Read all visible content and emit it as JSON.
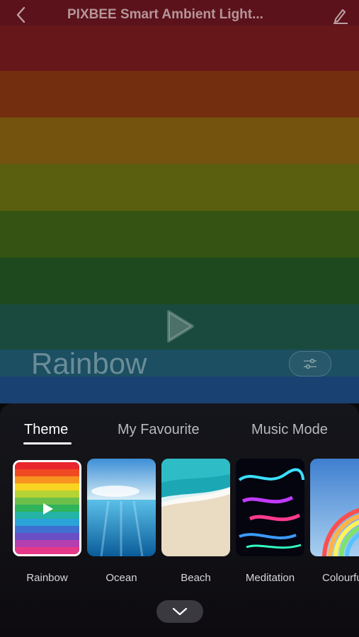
{
  "header": {
    "title": "PIXBEE Smart Ambient Light..."
  },
  "current_theme": "Rainbow",
  "background_colors": [
    "#b4282f",
    "#c0501a",
    "#c59019",
    "#98a118",
    "#5d8f1f",
    "#2f7d33",
    "#2c8068",
    "#2e7fa6",
    "#2b6fc4"
  ],
  "tabs": [
    {
      "label": "Theme",
      "active": true
    },
    {
      "label": "My Favourite",
      "active": false
    },
    {
      "label": "Music Mode",
      "active": false
    }
  ],
  "themes": [
    {
      "label": "Rainbow",
      "selected": true
    },
    {
      "label": "Ocean",
      "selected": false
    },
    {
      "label": "Beach",
      "selected": false
    },
    {
      "label": "Meditation",
      "selected": false
    },
    {
      "label": "Colourful",
      "selected": false
    }
  ]
}
